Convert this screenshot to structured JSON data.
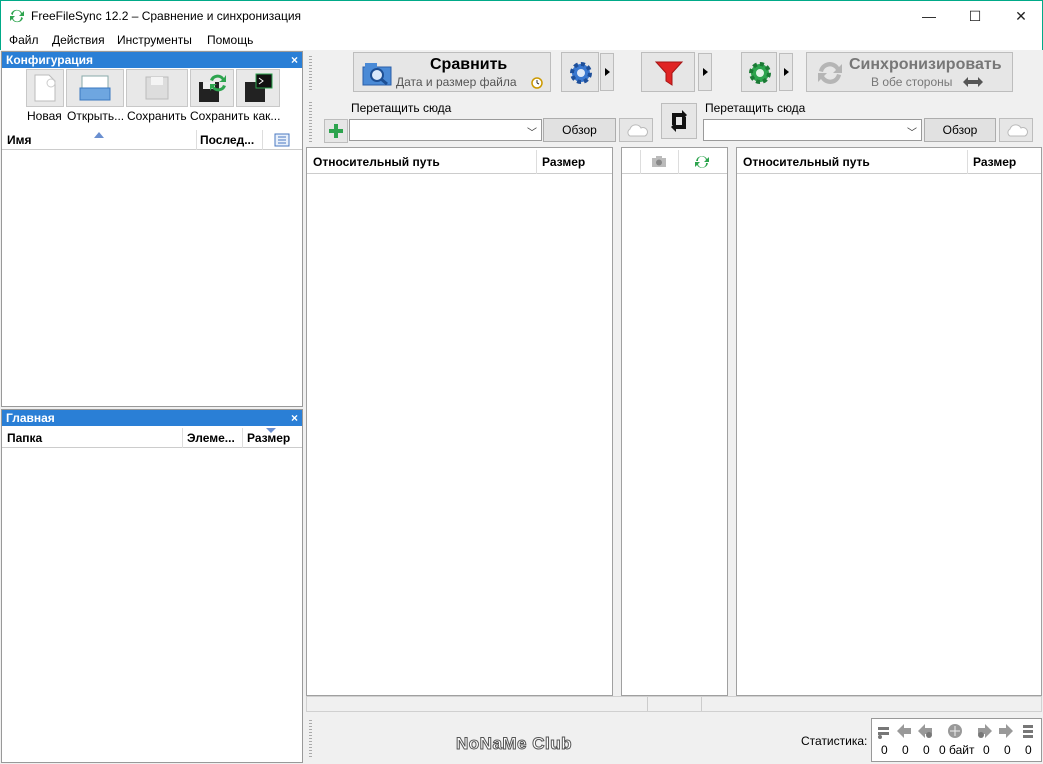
{
  "window": {
    "title": "FreeFileSync 12.2 – Сравнение и синхронизация",
    "minimize": "—",
    "maximize": "☐",
    "close": "✕"
  },
  "menu": [
    "Файл",
    "Действия",
    "Инструменты",
    "Помощь"
  ],
  "config_panel": {
    "title": "Конфигурация",
    "close": "×",
    "buttons": [
      {
        "label": "Новая",
        "icon": "new-file-icon"
      },
      {
        "label": "Открыть...",
        "icon": "open-folder-icon"
      },
      {
        "label": "Сохранить",
        "icon": "save-icon"
      },
      {
        "label": "Сохранить как...",
        "icon": "save-as-icon"
      },
      {
        "label": "",
        "icon": "save-batch-icon"
      }
    ],
    "columns": [
      "Имя",
      "Послед..."
    ]
  },
  "overview_panel": {
    "title": "Главная",
    "close": "×",
    "columns": [
      "Папка",
      "Элеме...",
      "Размер"
    ]
  },
  "toolbar": {
    "compare_label": "Сравнить",
    "compare_sub": "Дата и размер файла",
    "sync_label": "Синхронизировать",
    "sync_sub": "В обе стороны"
  },
  "folders": {
    "left_label": "Перетащить сюда",
    "right_label": "Перетащить сюда",
    "browse": "Обзор",
    "left_value": "",
    "right_value": ""
  },
  "grid": {
    "left_columns": [
      "Относительный путь",
      "Размер"
    ],
    "right_columns": [
      "Относительный путь",
      "Размер"
    ]
  },
  "status": {
    "watermark": "NoNaMe Club",
    "stats_label": "Статистика:",
    "counts": [
      "0",
      "0",
      "0",
      "0 байт",
      "0",
      "0",
      "0"
    ]
  }
}
